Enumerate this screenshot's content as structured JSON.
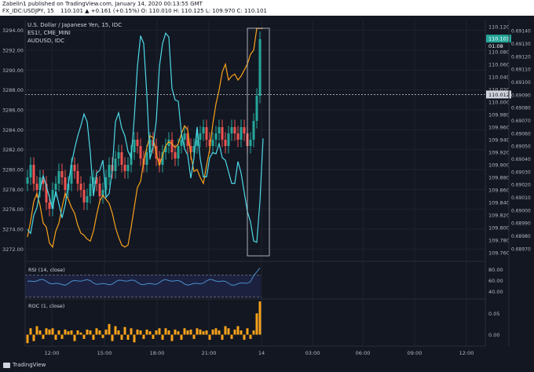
{
  "header": {
    "publisher": "Zabelin1 published on TradingView.com, January 14, 2020 00:13:55 GMT",
    "symbol": "FX_IDC:USDJPY, 15",
    "quote": "110.101 ▲ +0.161 (+0.15%) O: 110.010 H: 110.125 L: 109.970 C: 110.101"
  },
  "legend": {
    "main": "U.S. Dollar / Japanese Yen, 15, IDC",
    "es": "ES1!, CME_MINI",
    "aud": "AUDUSD, IDC"
  },
  "footer": {
    "brand": "TradingView"
  },
  "colors": {
    "bg": "#131722",
    "grid": "#1e2330",
    "up": "#26a69a",
    "down": "#ef5350",
    "es_line": "#f7a21b",
    "aud_line": "#4dd9e8",
    "rsi": "#4a90c8",
    "roc": "#f7a21b"
  },
  "chart_data": {
    "type": "line",
    "title": "U.S. Dollar / Japanese Yen, 15, IDC",
    "x_ticks": [
      "12:00",
      "15:00",
      "18:00",
      "21:00",
      "14",
      "03:00",
      "06:00",
      "09:00",
      "12:00"
    ],
    "left_axis": {
      "label_series": "ES1!",
      "ticks": [
        3272,
        3274,
        3276,
        3278,
        3280,
        3282,
        3284,
        3286,
        3288,
        3290,
        3292,
        3294
      ],
      "range": [
        3271,
        3295
      ]
    },
    "right_axis_1": {
      "label_series": "USDJPY",
      "ticks": [
        109.76,
        109.78,
        109.8,
        109.82,
        109.84,
        109.86,
        109.88,
        109.9,
        109.92,
        109.94,
        109.96,
        109.98,
        110.0,
        110.02,
        110.04,
        110.06,
        110.08,
        110.1,
        110.12
      ],
      "range": [
        109.75,
        110.13
      ]
    },
    "right_axis_2": {
      "label_series": "AUDUSD",
      "ticks": [
        0.6897,
        0.6898,
        0.6899,
        0.69,
        0.6901,
        0.6902,
        0.6903,
        0.6904,
        0.6905,
        0.6906,
        0.6907,
        0.6908,
        0.6909,
        0.691,
        0.6911,
        0.6912,
        0.6913,
        0.6914
      ],
      "range": [
        0.68962,
        0.69148
      ]
    },
    "price_marker": "110.012",
    "last_price": "110.101",
    "countdown": "01:08",
    "series": [
      {
        "name": "ES1!, CME_MINI",
        "axis": "left",
        "values": [
          3273.2,
          3274.8,
          3276.8,
          3277.6,
          3276.4,
          3274.6,
          3274.2,
          3272.6,
          3272.2,
          3273.8,
          3274.6,
          3276.2,
          3277.6,
          3277.0,
          3276.2,
          3275.6,
          3274.4,
          3273.6,
          3273.4,
          3273.0,
          3272.8,
          3273.8,
          3275.4,
          3276.8,
          3277.4,
          3277.0,
          3276.6,
          3275.6,
          3274.2,
          3273.2,
          3272.4,
          3272.2,
          3272.4,
          3274.2,
          3276.2,
          3278.2,
          3278.8,
          3280.8,
          3282.2,
          3283.4,
          3283.2,
          3281.6,
          3280.4,
          3281.4,
          3282.4,
          3282.8,
          3282.6,
          3282.2,
          3282.6,
          3283.6,
          3284.4,
          3284.0,
          3281.4,
          3279.8,
          3280.0,
          3279.2,
          3278.6,
          3280.4,
          3282.0,
          3284.6,
          3286.6,
          3288.0,
          3289.8,
          3290.6,
          3289.0,
          3289.4,
          3289.6,
          3289.0,
          3289.4,
          3290.0,
          3290.6,
          3291.6,
          3292.0,
          3294.2,
          3294.2,
          3294.2
        ]
      },
      {
        "name": "AUDUSD, IDC",
        "axis": "right2",
        "values": [
          0.68985,
          0.68982,
          0.68996,
          0.69002,
          0.69016,
          0.69027,
          0.69019,
          0.6901,
          0.69001,
          0.69015,
          0.69005,
          0.68994,
          0.69004,
          0.6902,
          0.69036,
          0.69048,
          0.69058,
          0.69066,
          0.69075,
          0.69069,
          0.69045,
          0.69011,
          0.69029,
          0.69031,
          0.69039,
          0.6901,
          0.69013,
          0.69032,
          0.69069,
          0.69076,
          0.69064,
          0.69058,
          0.69046,
          0.69041,
          0.69072,
          0.69112,
          0.69136,
          0.6913,
          0.6909,
          0.6904,
          0.6905,
          0.6907,
          0.69112,
          0.6913,
          0.69138,
          0.69135,
          0.69095,
          0.69086,
          0.69085,
          0.6906,
          0.69048,
          0.69043,
          0.69025,
          0.69041,
          0.69065,
          0.6904,
          0.69026,
          0.69026,
          0.69041,
          0.69045,
          0.69044,
          0.69052,
          0.69041,
          0.69039,
          0.6903,
          0.69021,
          0.69021,
          0.69038,
          0.69029,
          0.69014,
          0.68999,
          0.68991,
          0.68976,
          0.68975,
          0.69007,
          0.69056
        ]
      },
      {
        "name": "U.S. Dollar / Japanese Yen",
        "axis": "right1",
        "kind": "candles",
        "ohlc_close": [
          109.88,
          109.9,
          109.87,
          109.86,
          109.88,
          109.87,
          109.84,
          109.83,
          109.86,
          109.87,
          109.89,
          109.88,
          109.86,
          109.87,
          109.9,
          109.89,
          109.87,
          109.86,
          109.84,
          109.85,
          109.87,
          109.88,
          109.87,
          109.85,
          109.86,
          109.88,
          109.9,
          109.89,
          109.91,
          109.92,
          109.9,
          109.89,
          109.9,
          109.92,
          109.94,
          109.93,
          109.91,
          109.9,
          109.92,
          109.94,
          109.93,
          109.91,
          109.9,
          109.92,
          109.93,
          109.94,
          109.92,
          109.91,
          109.93,
          109.94,
          109.95,
          109.93,
          109.92,
          109.93,
          109.94,
          109.95,
          109.96,
          109.94,
          109.93,
          109.94,
          109.95,
          109.96,
          109.94,
          109.93,
          109.95,
          109.96,
          109.95,
          109.94,
          109.96,
          109.95,
          109.93,
          109.94,
          109.97,
          110.01,
          110.1
        ]
      }
    ],
    "rsi": {
      "label": "RSI (14, close)",
      "ticks": [
        40.0,
        60.0,
        80.0
      ],
      "range": [
        28,
        88
      ],
      "band": [
        30,
        70
      ]
    },
    "roc": {
      "label": "ROC (1, close)",
      "ticks": [
        0.0,
        0.05
      ],
      "range": [
        -0.025,
        0.08
      ],
      "values": [
        -0.02,
        0.015,
        -0.015,
        0.02,
        0.01,
        -0.01,
        0.015,
        0.012,
        0.015,
        -0.012,
        0.01,
        -0.01,
        0.012,
        0.008,
        0.01,
        -0.015,
        0.01,
        0.005,
        -0.01,
        0.012,
        0.01,
        -0.012,
        0.015,
        0.01,
        -0.008,
        0.012,
        0.025,
        -0.015,
        0.02,
        0.01,
        -0.012,
        0.018,
        -0.012,
        0.015,
        -0.018,
        0.012,
        0.01,
        -0.01,
        0.012,
        0.008,
        -0.01,
        0.01,
        0.015,
        -0.012,
        0.015,
        0.01,
        -0.015,
        0.012,
        0.008,
        -0.012,
        0.015,
        0.01,
        0.012,
        -0.01,
        0.015,
        0.012,
        0.008,
        0.01,
        -0.012,
        0.012,
        0.015,
        0.01,
        -0.012,
        0.02,
        0.015,
        -0.01,
        0.012,
        0.02,
        0.01,
        -0.012,
        0.015,
        -0.01,
        0.01,
        0.05,
        0.078
      ]
    }
  }
}
